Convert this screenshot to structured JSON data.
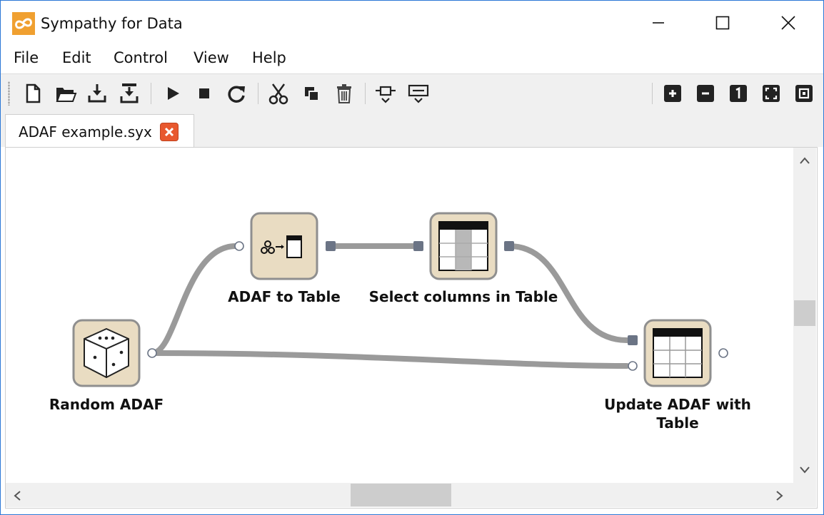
{
  "window": {
    "title": "Sympathy for Data",
    "app_icon": "sympathy-logo-icon",
    "controls": [
      "minimize-icon",
      "maximize-icon",
      "close-icon"
    ]
  },
  "menu": {
    "items": [
      {
        "label": "File"
      },
      {
        "label": "Edit"
      },
      {
        "label": "Control"
      },
      {
        "label": "View"
      },
      {
        "label": "Help"
      }
    ]
  },
  "toolbar": {
    "left_icons": [
      "new-file-icon",
      "open-folder-icon",
      "save-icon",
      "save-as-icon",
      "execute-icon",
      "stop-icon",
      "reload-icon",
      "cut-icon",
      "copy-icon",
      "delete-icon",
      "insert-subflow-icon",
      "toggle-messages-icon"
    ],
    "right_icons": [
      "zoom-in-icon",
      "zoom-out-icon",
      "zoom-reset-icon",
      "zoom-fit-icon",
      "zoom-selection-icon"
    ]
  },
  "tabs": [
    {
      "label": "ADAF example.syx",
      "close_icon": "tab-close-icon"
    }
  ],
  "flow": {
    "nodes": [
      {
        "id": "random-adaf",
        "label": "Random ADAF",
        "icon": "dice-icon"
      },
      {
        "id": "adaf-to-table",
        "label": "ADAF to Table",
        "icon": "adaf-to-table-icon"
      },
      {
        "id": "select-columns",
        "label": "Select columns in Table",
        "icon": "select-columns-icon"
      },
      {
        "id": "update-adaf",
        "label": "Update ADAF with Table",
        "icon": "table-icon"
      }
    ],
    "connections": [
      {
        "from": "random-adaf",
        "to": "adaf-to-table"
      },
      {
        "from": "random-adaf",
        "to": "update-adaf"
      },
      {
        "from": "adaf-to-table",
        "to": "select-columns"
      },
      {
        "from": "select-columns",
        "to": "update-adaf"
      }
    ],
    "colors": {
      "node_fill": "#e9dcc2",
      "node_border": "#8f8f8f",
      "connection": "#9a9a9a",
      "port": "#6b7485"
    }
  },
  "scrollbars": {
    "vertical": {
      "position_fraction": 0.44
    },
    "horizontal": {
      "position_fraction": 0.52
    }
  }
}
